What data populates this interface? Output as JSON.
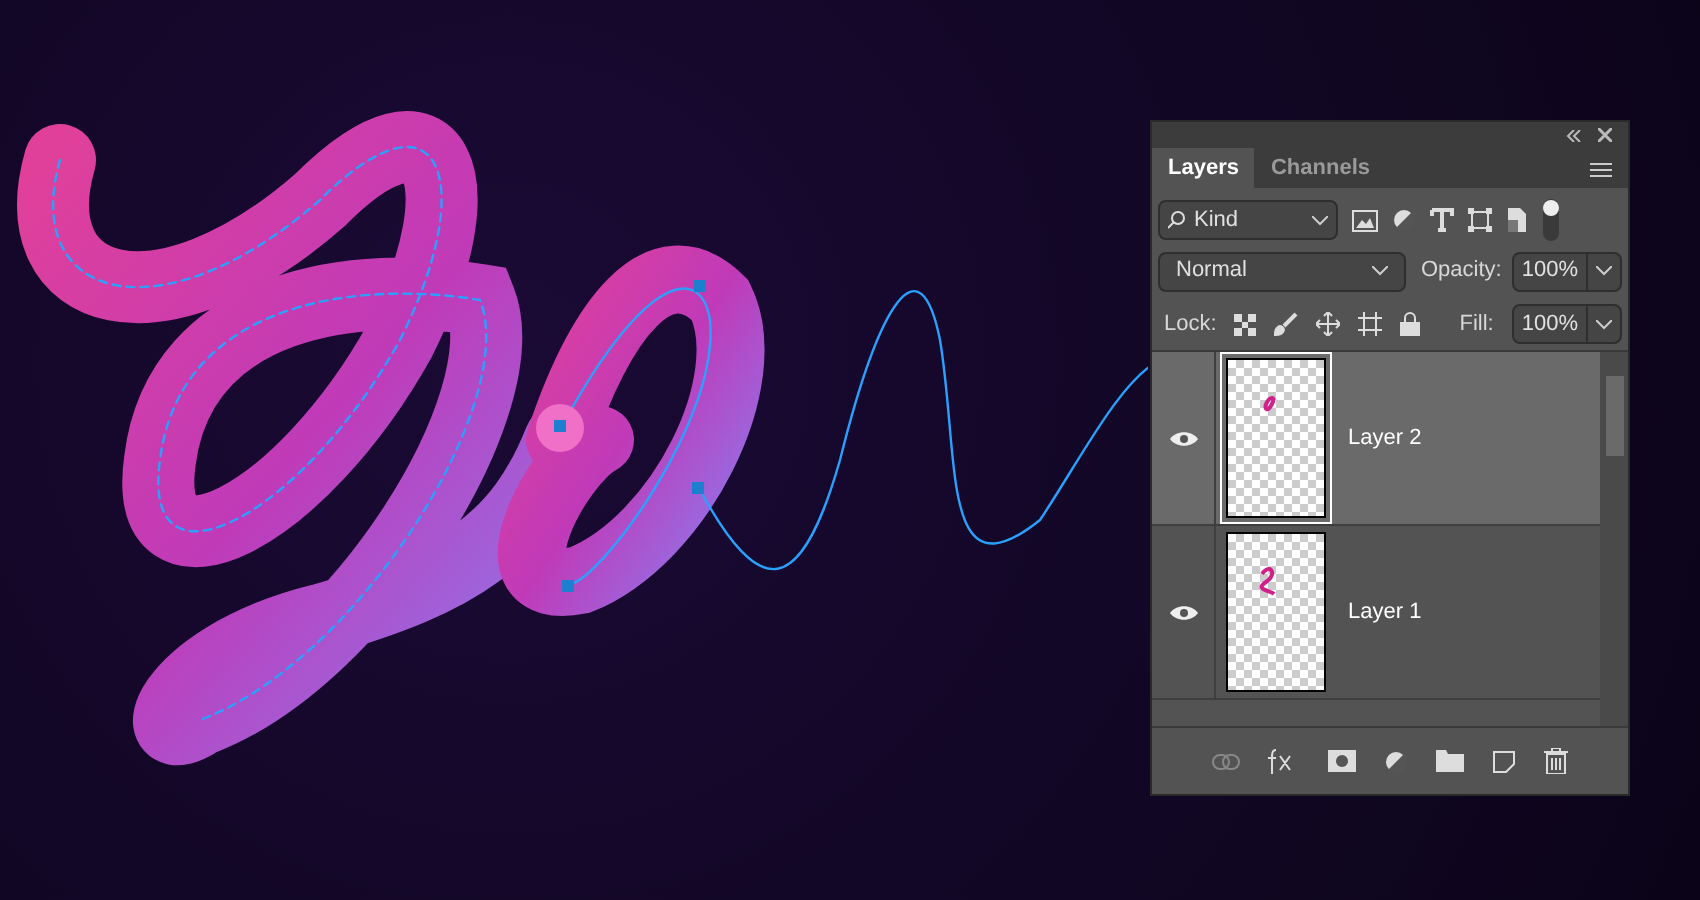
{
  "panel": {
    "tabs": [
      {
        "label": "Layers",
        "selected": true
      },
      {
        "label": "Channels",
        "selected": false
      }
    ],
    "filter": {
      "label": "Kind"
    },
    "blend_mode": "Normal",
    "opacity": {
      "label": "Opacity:",
      "value": "100%"
    },
    "lock": {
      "label": "Lock:"
    },
    "fill": {
      "label": "Fill:",
      "value": "100%"
    },
    "layers": [
      {
        "name": "Layer 2",
        "selected": true,
        "visible": true
      },
      {
        "name": "Layer 1",
        "selected": false,
        "visible": true
      }
    ]
  }
}
